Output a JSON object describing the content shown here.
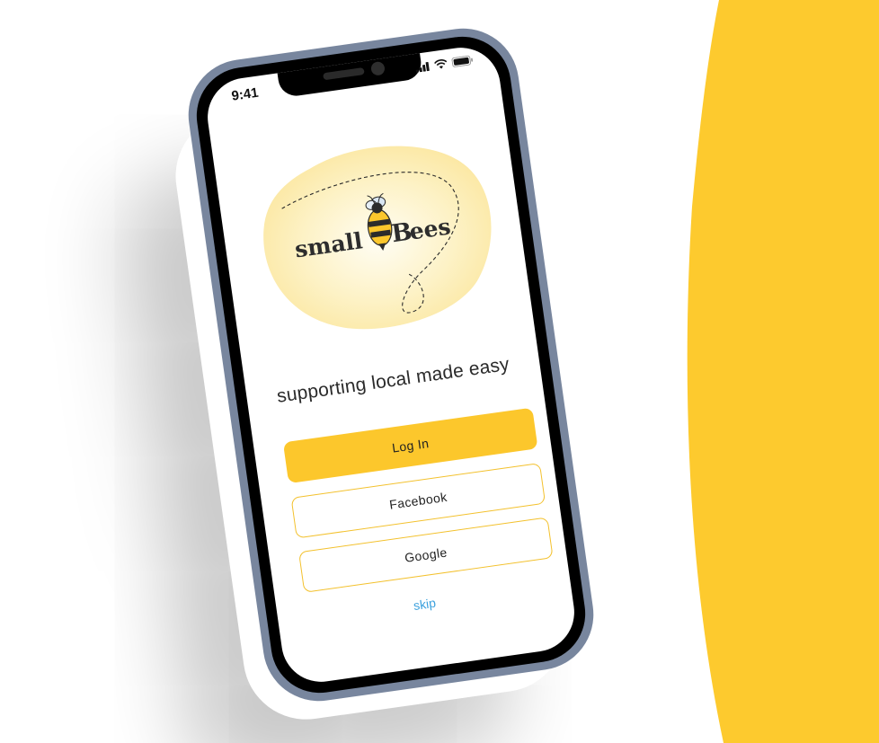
{
  "colors": {
    "accent": "#fcc72c",
    "button_border": "#f3c12d",
    "phone_frame": "#78869e",
    "link": "#3aa0dd",
    "logo_blob": "#fbe9a6"
  },
  "status_bar": {
    "time": "9:41",
    "icons": [
      "signal-icon",
      "wifi-icon",
      "battery-icon"
    ]
  },
  "logo": {
    "text_left": "small",
    "text_right": "ees",
    "letter": "B",
    "icon": "bee-icon"
  },
  "tagline": "supporting local made easy",
  "buttons": {
    "login": "Log In",
    "facebook": "Facebook",
    "google": "Google"
  },
  "skip": "skip"
}
